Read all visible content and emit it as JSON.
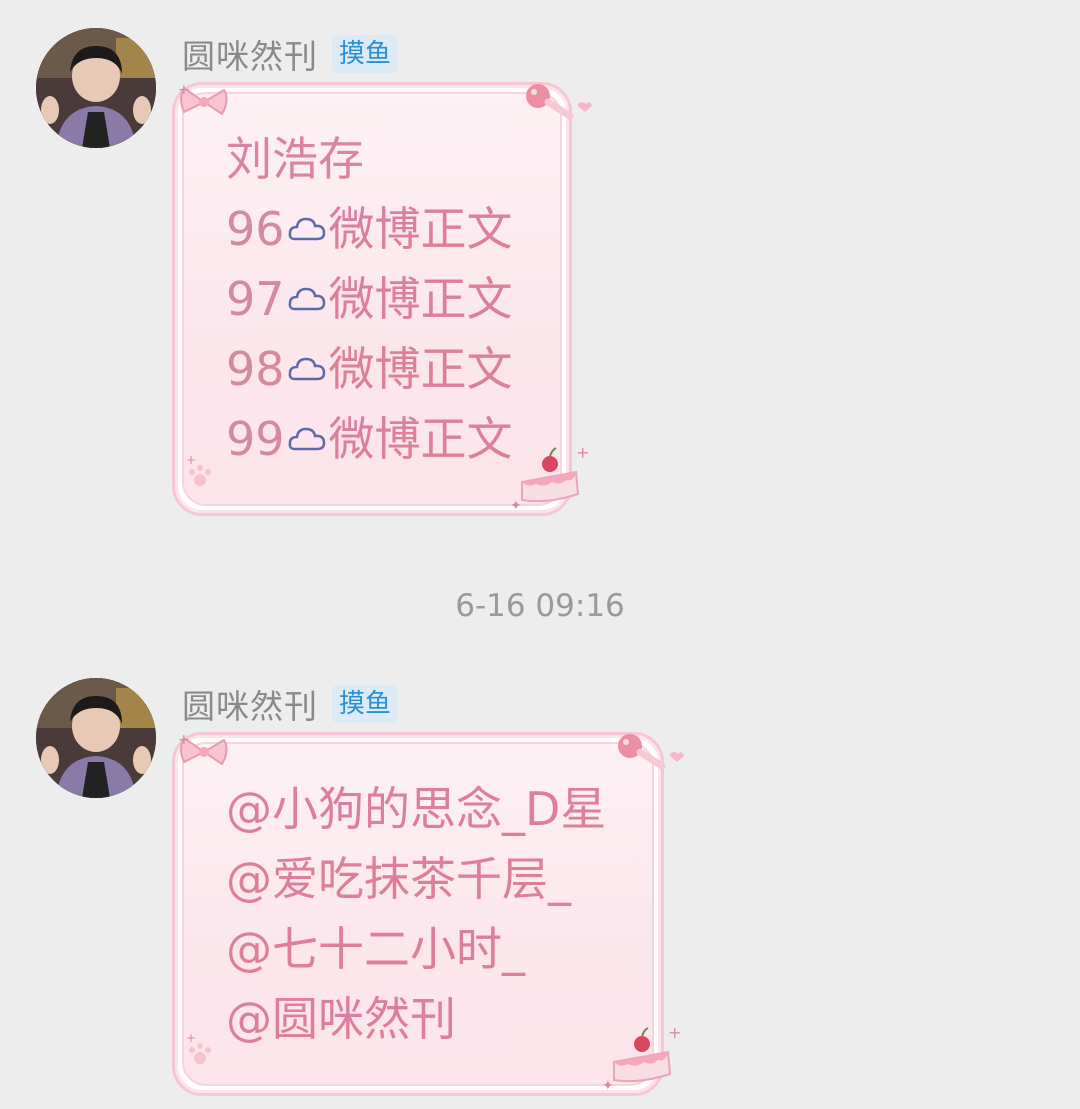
{
  "messages": [
    {
      "sender": "圆咪然刊",
      "tag": "摸鱼",
      "lines": [
        {
          "num": "",
          "text": "刘浩存"
        },
        {
          "num": "96",
          "text": "微博正文"
        },
        {
          "num": "97",
          "text": "微博正文"
        },
        {
          "num": "98",
          "text": "微博正文"
        },
        {
          "num": "99",
          "text": "微博正文"
        }
      ]
    },
    {
      "sender": "圆咪然刊",
      "tag": "摸鱼",
      "lines": [
        {
          "num": "",
          "text": "@小狗的思念_D星"
        },
        {
          "num": "",
          "text": "@爱吃抹茶千层_"
        },
        {
          "num": "",
          "text": "@七十二小时_"
        },
        {
          "num": "",
          "text": "@圆咪然刊"
        }
      ]
    }
  ],
  "timestamp": "6-16 09:16",
  "icons": {
    "cloud": "cloud-icon",
    "bow": "bow-icon",
    "cake": "cake-icon",
    "heart": "heart-icon"
  },
  "colors": {
    "text_pink": "#dc7f9c",
    "bubble_border": "#f5c6d4",
    "tag_blue": "#2b8fd6",
    "background": "#ededed"
  }
}
